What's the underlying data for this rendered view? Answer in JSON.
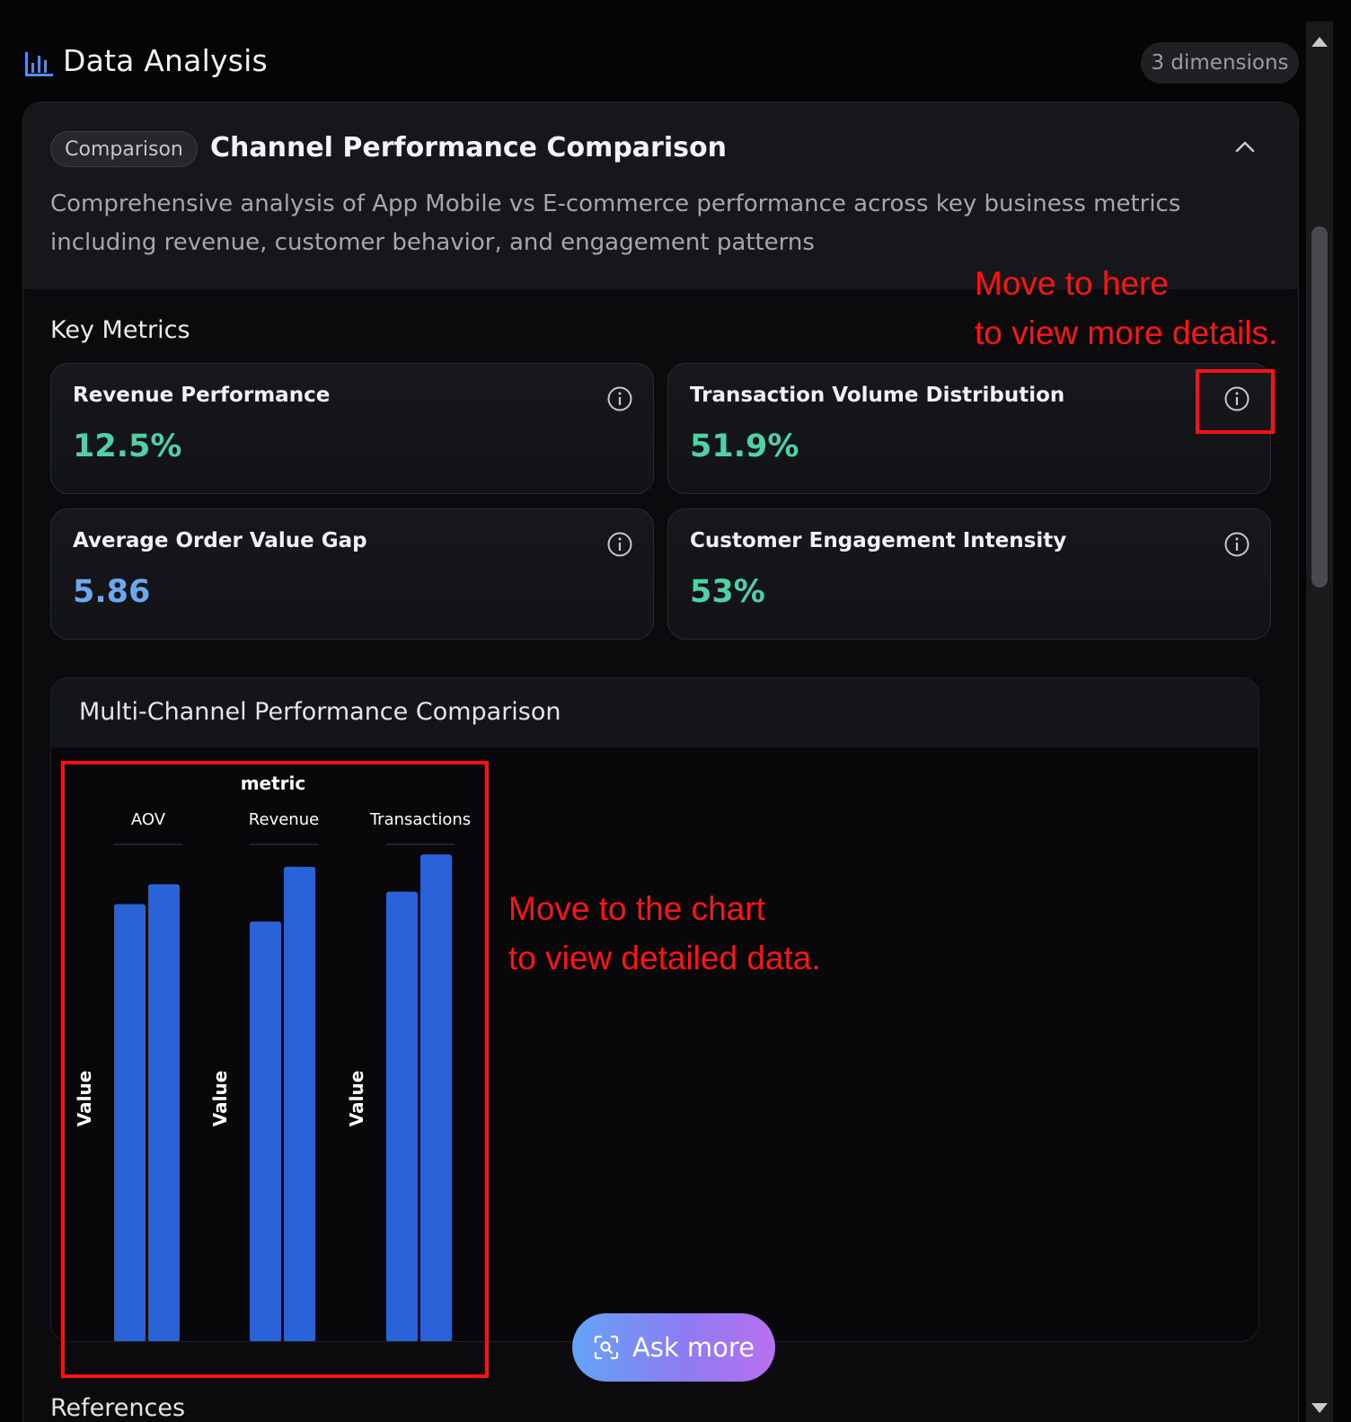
{
  "header": {
    "title": "Data Analysis",
    "dimensions_badge": "3 dimensions",
    "icon": "bar-chart-icon"
  },
  "card": {
    "badge": "Comparison",
    "title": "Channel Performance Comparison",
    "description": "Comprehensive analysis of App Mobile vs E-commerce performance across key business metrics including revenue, customer behavior, and engagement patterns",
    "collapse_icon": "chevron-up-icon"
  },
  "key_metrics": {
    "label": "Key Metrics",
    "items": [
      {
        "title": "Revenue Performance",
        "value": "12.5%",
        "color": "#4fd1a5",
        "icon": "info-icon"
      },
      {
        "title": "Transaction Volume Distribution",
        "value": "51.9%",
        "color": "#4fd1a5",
        "icon": "info-icon"
      },
      {
        "title": "Average Order Value Gap",
        "value": "5.86",
        "color": "#6aa8f0",
        "icon": "info-icon"
      },
      {
        "title": "Customer Engagement Intensity",
        "value": "53%",
        "color": "#4fd1a5",
        "icon": "info-icon"
      }
    ]
  },
  "chart_panel": {
    "title": "Multi-Channel Performance Comparison"
  },
  "chart_data": {
    "type": "bar",
    "facet_title": "metric",
    "facets": [
      "AOV",
      "Revenue",
      "Transactions"
    ],
    "ylabel": "Value",
    "bar_color": "#2a63d8",
    "series_values": [
      [
        0.88,
        0.92
      ],
      [
        0.845,
        0.955
      ],
      [
        0.905,
        0.98
      ]
    ]
  },
  "ask_button": {
    "label": "Ask more",
    "icon": "scan-search-icon"
  },
  "references": {
    "label": "References"
  },
  "annotations": {
    "info_hint": [
      "Move to here",
      "to view more details."
    ],
    "chart_hint": [
      "Move to the chart",
      "to view detailed data."
    ]
  }
}
